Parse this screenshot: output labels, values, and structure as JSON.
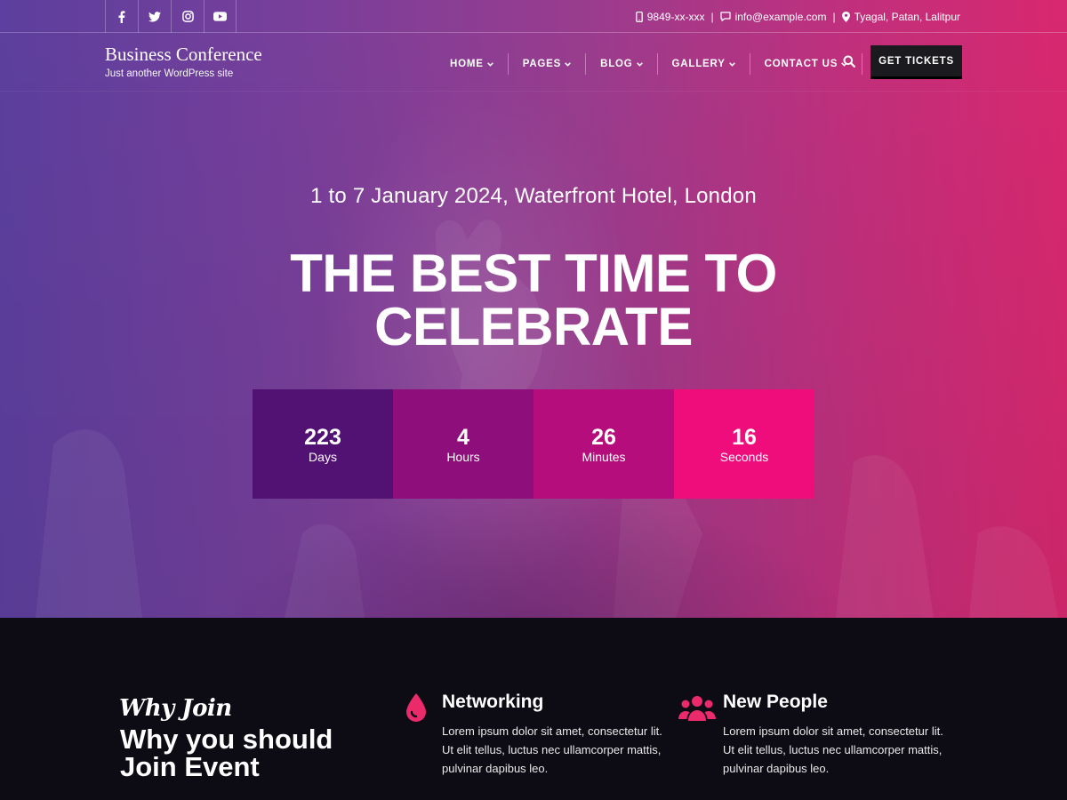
{
  "topbar": {
    "social": [
      "facebook-icon",
      "twitter-icon",
      "instagram-icon",
      "youtube-icon"
    ],
    "phone": "9849-xx-xxx",
    "email": "info@example.com",
    "address": "Tyagal, Patan, Lalitpur",
    "separator": "|"
  },
  "brand": {
    "title": "Business Conference",
    "tagline": "Just another WordPress site"
  },
  "nav": {
    "items": [
      "HOME",
      "PAGES",
      "BLOG",
      "GALLERY",
      "CONTACT US"
    ],
    "cta": "GET TICKETS"
  },
  "hero": {
    "date": "1 to 7 January 2024, Waterfront Hotel, London",
    "headline": "THE BEST TIME TO CELEBRATE",
    "countdown": [
      {
        "value": "223",
        "label": "Days",
        "color": "#521274"
      },
      {
        "value": "4",
        "label": "Hours",
        "color": "#8e0f7b"
      },
      {
        "value": "26",
        "label": "Minutes",
        "color": "#b50d7b"
      },
      {
        "value": "16",
        "label": "Seconds",
        "color": "#ef0c7b"
      }
    ]
  },
  "why": {
    "script": "Why Join",
    "heading": "Why you should Join Event"
  },
  "features": [
    {
      "icon": "drop-icon",
      "title": "Networking",
      "text": "Lorem ipsum dolor sit amet, consectetur lit. Ut elit tellus, luctus nec ullamcorper mattis, pulvinar dapibus leo."
    },
    {
      "icon": "users-icon",
      "title": "New People",
      "text": "Lorem ipsum dolor sit amet, consectetur lit. Ut elit tellus, luctus nec ullamcorper mattis, pulvinar dapibus leo."
    }
  ],
  "colors": {
    "accent": "#ea2a6a",
    "button": "#1a1a1f",
    "section_bg": "#0d0b14"
  }
}
